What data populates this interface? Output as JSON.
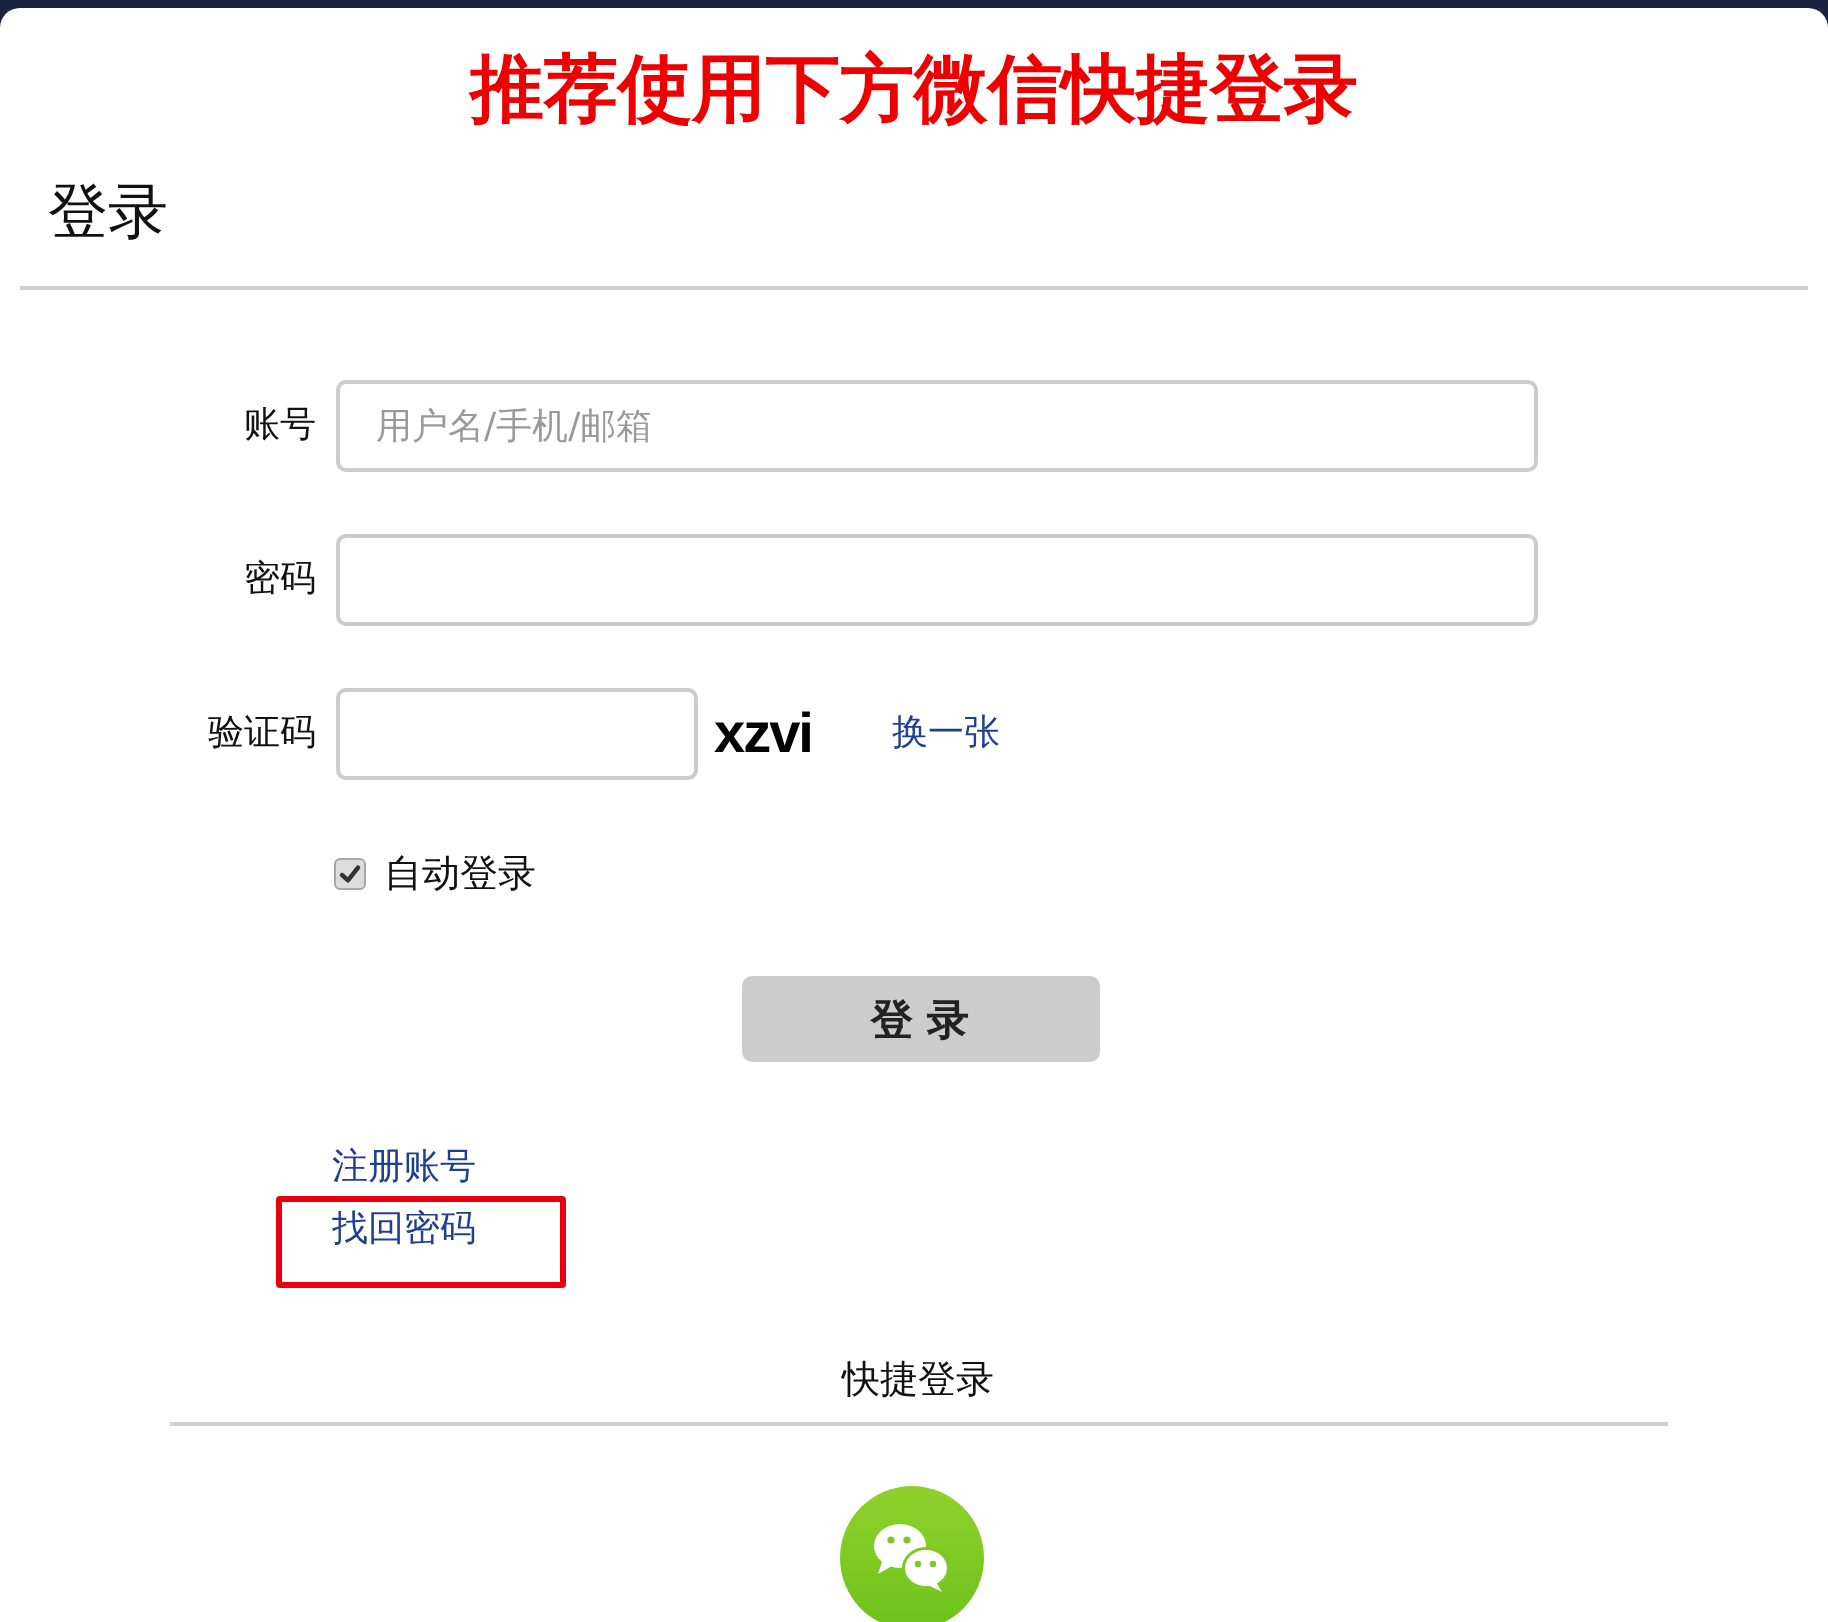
{
  "banner": {
    "text": "推荐使用下方微信快捷登录"
  },
  "heading": "登录",
  "fields": [
    {
      "kind": "text",
      "label": "账号",
      "placeholder": "用户名/手机/邮箱"
    },
    {
      "kind": "password",
      "label": "密码"
    },
    {
      "kind": "captcha",
      "label": "验证码",
      "captcha": "xzvi",
      "refresh_link": "换一张"
    }
  ],
  "auto_login": {
    "label": "自动登录",
    "checked": true
  },
  "submit_button": "登 录",
  "links": [
    {
      "label": "注册账号",
      "highlighted": false
    },
    {
      "label": "找回密码",
      "highlighted": true
    }
  ],
  "quick_login": {
    "title": "快捷登录"
  }
}
